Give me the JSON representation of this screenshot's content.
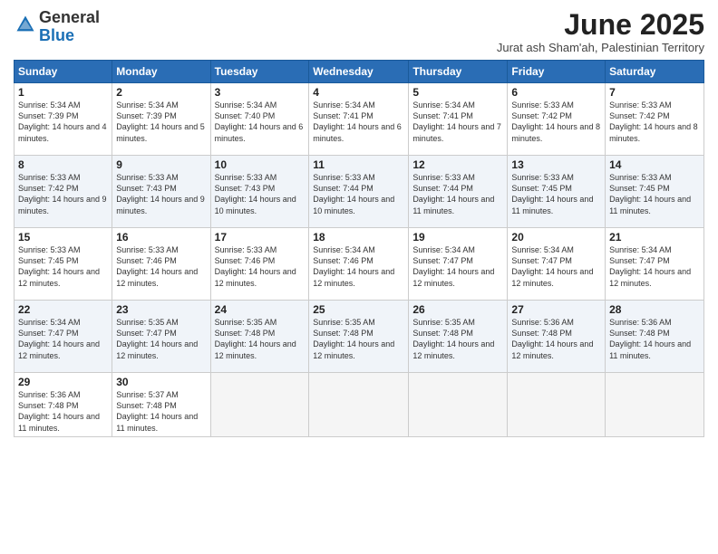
{
  "logo": {
    "general": "General",
    "blue": "Blue"
  },
  "header": {
    "month": "June 2025",
    "location": "Jurat ash Sham'ah, Palestinian Territory"
  },
  "weekdays": [
    "Sunday",
    "Monday",
    "Tuesday",
    "Wednesday",
    "Thursday",
    "Friday",
    "Saturday"
  ],
  "weeks": [
    [
      {
        "day": "1",
        "sunrise": "5:34 AM",
        "sunset": "7:39 PM",
        "daylight": "14 hours and 4 minutes."
      },
      {
        "day": "2",
        "sunrise": "5:34 AM",
        "sunset": "7:39 PM",
        "daylight": "14 hours and 5 minutes."
      },
      {
        "day": "3",
        "sunrise": "5:34 AM",
        "sunset": "7:40 PM",
        "daylight": "14 hours and 6 minutes."
      },
      {
        "day": "4",
        "sunrise": "5:34 AM",
        "sunset": "7:41 PM",
        "daylight": "14 hours and 6 minutes."
      },
      {
        "day": "5",
        "sunrise": "5:34 AM",
        "sunset": "7:41 PM",
        "daylight": "14 hours and 7 minutes."
      },
      {
        "day": "6",
        "sunrise": "5:33 AM",
        "sunset": "7:42 PM",
        "daylight": "14 hours and 8 minutes."
      },
      {
        "day": "7",
        "sunrise": "5:33 AM",
        "sunset": "7:42 PM",
        "daylight": "14 hours and 8 minutes."
      }
    ],
    [
      {
        "day": "8",
        "sunrise": "5:33 AM",
        "sunset": "7:42 PM",
        "daylight": "14 hours and 9 minutes."
      },
      {
        "day": "9",
        "sunrise": "5:33 AM",
        "sunset": "7:43 PM",
        "daylight": "14 hours and 9 minutes."
      },
      {
        "day": "10",
        "sunrise": "5:33 AM",
        "sunset": "7:43 PM",
        "daylight": "14 hours and 10 minutes."
      },
      {
        "day": "11",
        "sunrise": "5:33 AM",
        "sunset": "7:44 PM",
        "daylight": "14 hours and 10 minutes."
      },
      {
        "day": "12",
        "sunrise": "5:33 AM",
        "sunset": "7:44 PM",
        "daylight": "14 hours and 11 minutes."
      },
      {
        "day": "13",
        "sunrise": "5:33 AM",
        "sunset": "7:45 PM",
        "daylight": "14 hours and 11 minutes."
      },
      {
        "day": "14",
        "sunrise": "5:33 AM",
        "sunset": "7:45 PM",
        "daylight": "14 hours and 11 minutes."
      }
    ],
    [
      {
        "day": "15",
        "sunrise": "5:33 AM",
        "sunset": "7:45 PM",
        "daylight": "14 hours and 12 minutes."
      },
      {
        "day": "16",
        "sunrise": "5:33 AM",
        "sunset": "7:46 PM",
        "daylight": "14 hours and 12 minutes."
      },
      {
        "day": "17",
        "sunrise": "5:33 AM",
        "sunset": "7:46 PM",
        "daylight": "14 hours and 12 minutes."
      },
      {
        "day": "18",
        "sunrise": "5:34 AM",
        "sunset": "7:46 PM",
        "daylight": "14 hours and 12 minutes."
      },
      {
        "day": "19",
        "sunrise": "5:34 AM",
        "sunset": "7:47 PM",
        "daylight": "14 hours and 12 minutes."
      },
      {
        "day": "20",
        "sunrise": "5:34 AM",
        "sunset": "7:47 PM",
        "daylight": "14 hours and 12 minutes."
      },
      {
        "day": "21",
        "sunrise": "5:34 AM",
        "sunset": "7:47 PM",
        "daylight": "14 hours and 12 minutes."
      }
    ],
    [
      {
        "day": "22",
        "sunrise": "5:34 AM",
        "sunset": "7:47 PM",
        "daylight": "14 hours and 12 minutes."
      },
      {
        "day": "23",
        "sunrise": "5:35 AM",
        "sunset": "7:47 PM",
        "daylight": "14 hours and 12 minutes."
      },
      {
        "day": "24",
        "sunrise": "5:35 AM",
        "sunset": "7:48 PM",
        "daylight": "14 hours and 12 minutes."
      },
      {
        "day": "25",
        "sunrise": "5:35 AM",
        "sunset": "7:48 PM",
        "daylight": "14 hours and 12 minutes."
      },
      {
        "day": "26",
        "sunrise": "5:35 AM",
        "sunset": "7:48 PM",
        "daylight": "14 hours and 12 minutes."
      },
      {
        "day": "27",
        "sunrise": "5:36 AM",
        "sunset": "7:48 PM",
        "daylight": "14 hours and 12 minutes."
      },
      {
        "day": "28",
        "sunrise": "5:36 AM",
        "sunset": "7:48 PM",
        "daylight": "14 hours and 11 minutes."
      }
    ],
    [
      {
        "day": "29",
        "sunrise": "5:36 AM",
        "sunset": "7:48 PM",
        "daylight": "14 hours and 11 minutes."
      },
      {
        "day": "30",
        "sunrise": "5:37 AM",
        "sunset": "7:48 PM",
        "daylight": "14 hours and 11 minutes."
      },
      null,
      null,
      null,
      null,
      null
    ]
  ]
}
